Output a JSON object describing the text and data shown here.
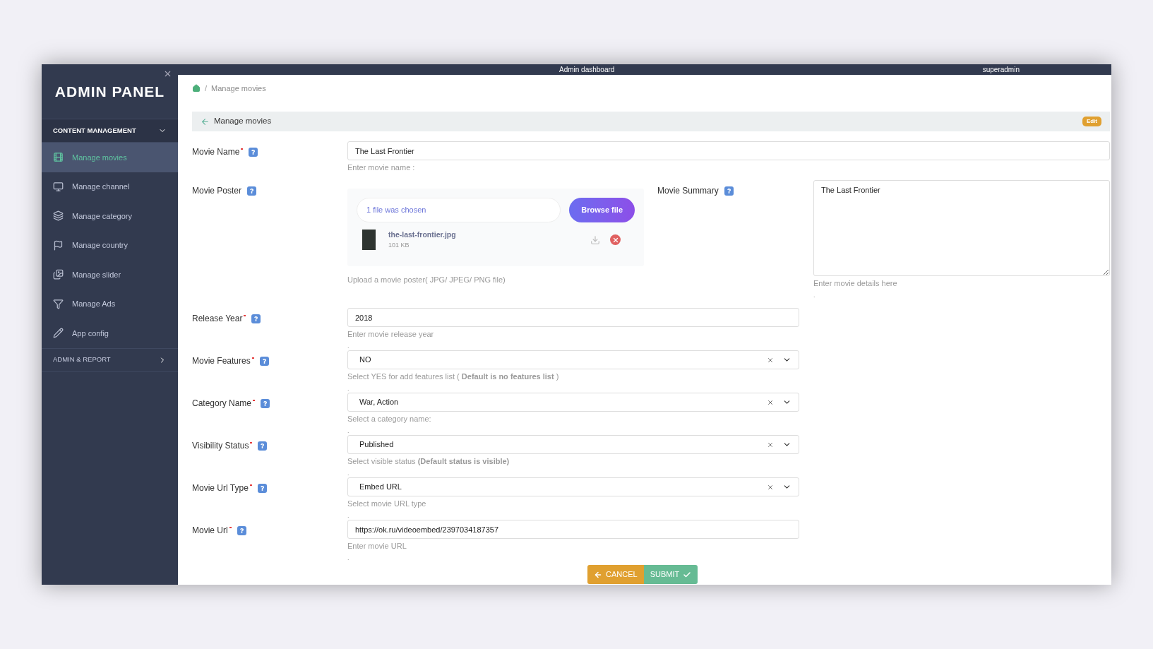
{
  "top_bar": {
    "title": "Admin dashboard",
    "user": "superadmin"
  },
  "sidebar": {
    "logo": "ADMIN PANEL",
    "sections": [
      {
        "title": "CONTENT MANAGEMENT",
        "expanded": true,
        "items": [
          {
            "label": "Manage movies",
            "selected": true
          },
          {
            "label": "Manage channel",
            "selected": false
          },
          {
            "label": "Manage category",
            "selected": false
          },
          {
            "label": "Manage country",
            "selected": false
          },
          {
            "label": "Manage slider",
            "selected": false
          },
          {
            "label": "Manage Ads",
            "selected": false
          },
          {
            "label": "App config",
            "selected": false
          }
        ]
      },
      {
        "title": "ADMIN & REPORT",
        "expanded": false
      }
    ]
  },
  "breadcrumb": {
    "separator": "/",
    "items": [
      "Manage movies"
    ]
  },
  "header": {
    "title": "Manage movies",
    "badge": "Edit"
  },
  "movie_name": {
    "label": "Movie Name",
    "required": true,
    "value": "The Last Frontier",
    "hint": "Enter movie name :"
  },
  "poster": {
    "label": "Movie Poster",
    "chosen_text": "1 file was chosen",
    "browse_button": "Browse file",
    "file": {
      "name": "the-last-frontier.jpg",
      "size": "101 KB"
    },
    "hint": "Upload a movie poster( JPG/ JPEG/ PNG file)"
  },
  "summary": {
    "label": "Movie Summary",
    "value": "The Last Frontier",
    "hint": "Enter movie details here",
    "trailer": "."
  },
  "fields": [
    {
      "kind": "text",
      "label": "Release Year",
      "required": true,
      "value": "2018",
      "hint": "Enter movie release year",
      "trailer": "."
    },
    {
      "kind": "select",
      "label": "Movie Features",
      "required": true,
      "value": "NO",
      "hint": "Select YES for add features list ( **Default is no features list** )",
      "trailer": "."
    },
    {
      "kind": "select",
      "label": "Category Name",
      "required": true,
      "value": "War, Action",
      "hint": "Select a category name:",
      "trailer": "."
    },
    {
      "kind": "select",
      "label": "Visibility Status",
      "required": true,
      "value": "Published",
      "hint": "Select visible status **(Default status is visible)**",
      "trailer": "."
    },
    {
      "kind": "select",
      "label": "Movie Url Type",
      "required": true,
      "value": "Embed URL",
      "hint": "Select movie URL type",
      "trailer": "."
    },
    {
      "kind": "text",
      "label": "Movie Url",
      "required": true,
      "value": "https://ok.ru/videoembed/2397034187357",
      "hint": "Enter movie URL",
      "trailer": "."
    }
  ],
  "buttons": [
    {
      "kind": "cancel",
      "label": "CANCEL"
    },
    {
      "kind": "submit",
      "label": "SUBMIT"
    }
  ]
}
